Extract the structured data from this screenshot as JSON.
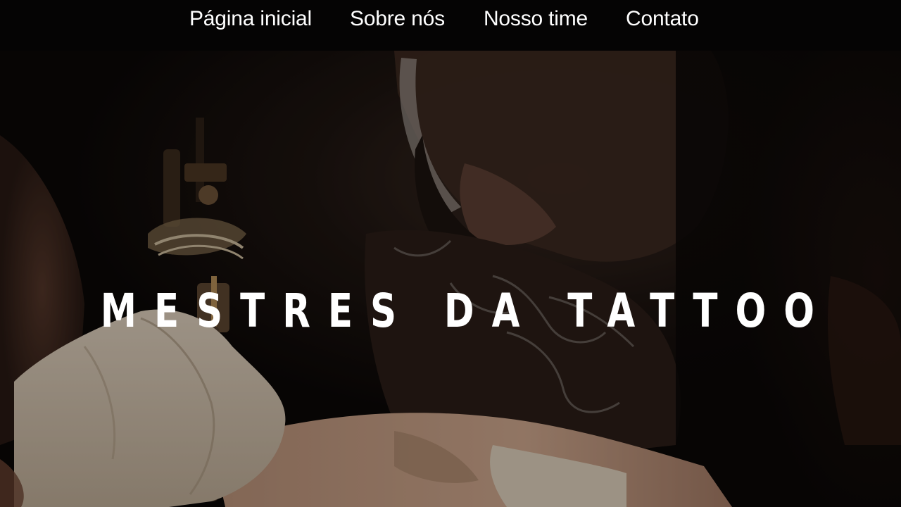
{
  "nav": {
    "items": [
      {
        "label": "Página inicial"
      },
      {
        "label": "Sobre nós"
      },
      {
        "label": "Nosso time"
      },
      {
        "label": "Contato"
      }
    ]
  },
  "hero": {
    "title": "MESTRES DA TATTOO",
    "image": "tattoo-artist-photo"
  },
  "colors": {
    "nav_background": "#050404",
    "nav_text": "#ffffff",
    "hero_text": "#ffffff"
  }
}
